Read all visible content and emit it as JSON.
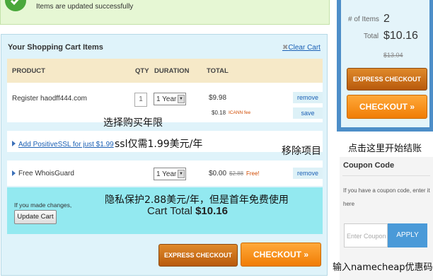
{
  "banner": {
    "text": "Items are updated successfully"
  },
  "cart": {
    "title": "Your Shopping Cart Items",
    "clear_cart": "Clear Cart",
    "headers": {
      "product": "PRODUCT",
      "qty": "QTY",
      "duration": "DURATION",
      "total": "TOTAL"
    },
    "item1": {
      "name": "Register haodff444.com",
      "qty": "1",
      "duration": "1 Year",
      "total": "$9.98",
      "fee": "$0.18",
      "fee_label": "ICANN fee",
      "remove": "remove",
      "save": "save"
    },
    "ssl_offer": "Add PositiveSSL for just $1.99",
    "item2": {
      "name": "Free WhoisGuard",
      "duration": "1 Year",
      "total": "$0.00",
      "old_price": "$2.88",
      "free": "Free!",
      "remove": "remove"
    },
    "changes_text": "If you made changes,",
    "update_button": "Update Cart",
    "cart_total_label": "Cart Total",
    "cart_total_value": "$10.16",
    "express_checkout": "EXPRESS CHECKOUT",
    "checkout": "CHECKOUT »"
  },
  "summary": {
    "items_label": "# of Items",
    "items_value": "2",
    "total_label": "Total",
    "total_value": "$10.16",
    "old_total": "$13.04",
    "express_checkout": "EXPRESS CHECKOUT",
    "checkout": "CHECKOUT »"
  },
  "coupon": {
    "title": "Coupon Code",
    "text": "If you have a coupon code, enter it here",
    "placeholder": "Enter Coupon",
    "apply": "APPLY"
  },
  "annotations": {
    "choose_year": "选择购买年限",
    "ssl_price": "ssl仅需1.99美元/年",
    "remove_item": "移除项目",
    "click_checkout": "点击这里开始结账",
    "privacy": "隐私保护2.88美元/年，但是首年免费使用",
    "coupon_hint": "输入namecheap优惠码"
  },
  "colors": {
    "accent": "#1a5fb4",
    "checkout_orange": "#f07d05",
    "express_brown": "#b85a0c",
    "summary_border": "#4d8ec8"
  }
}
